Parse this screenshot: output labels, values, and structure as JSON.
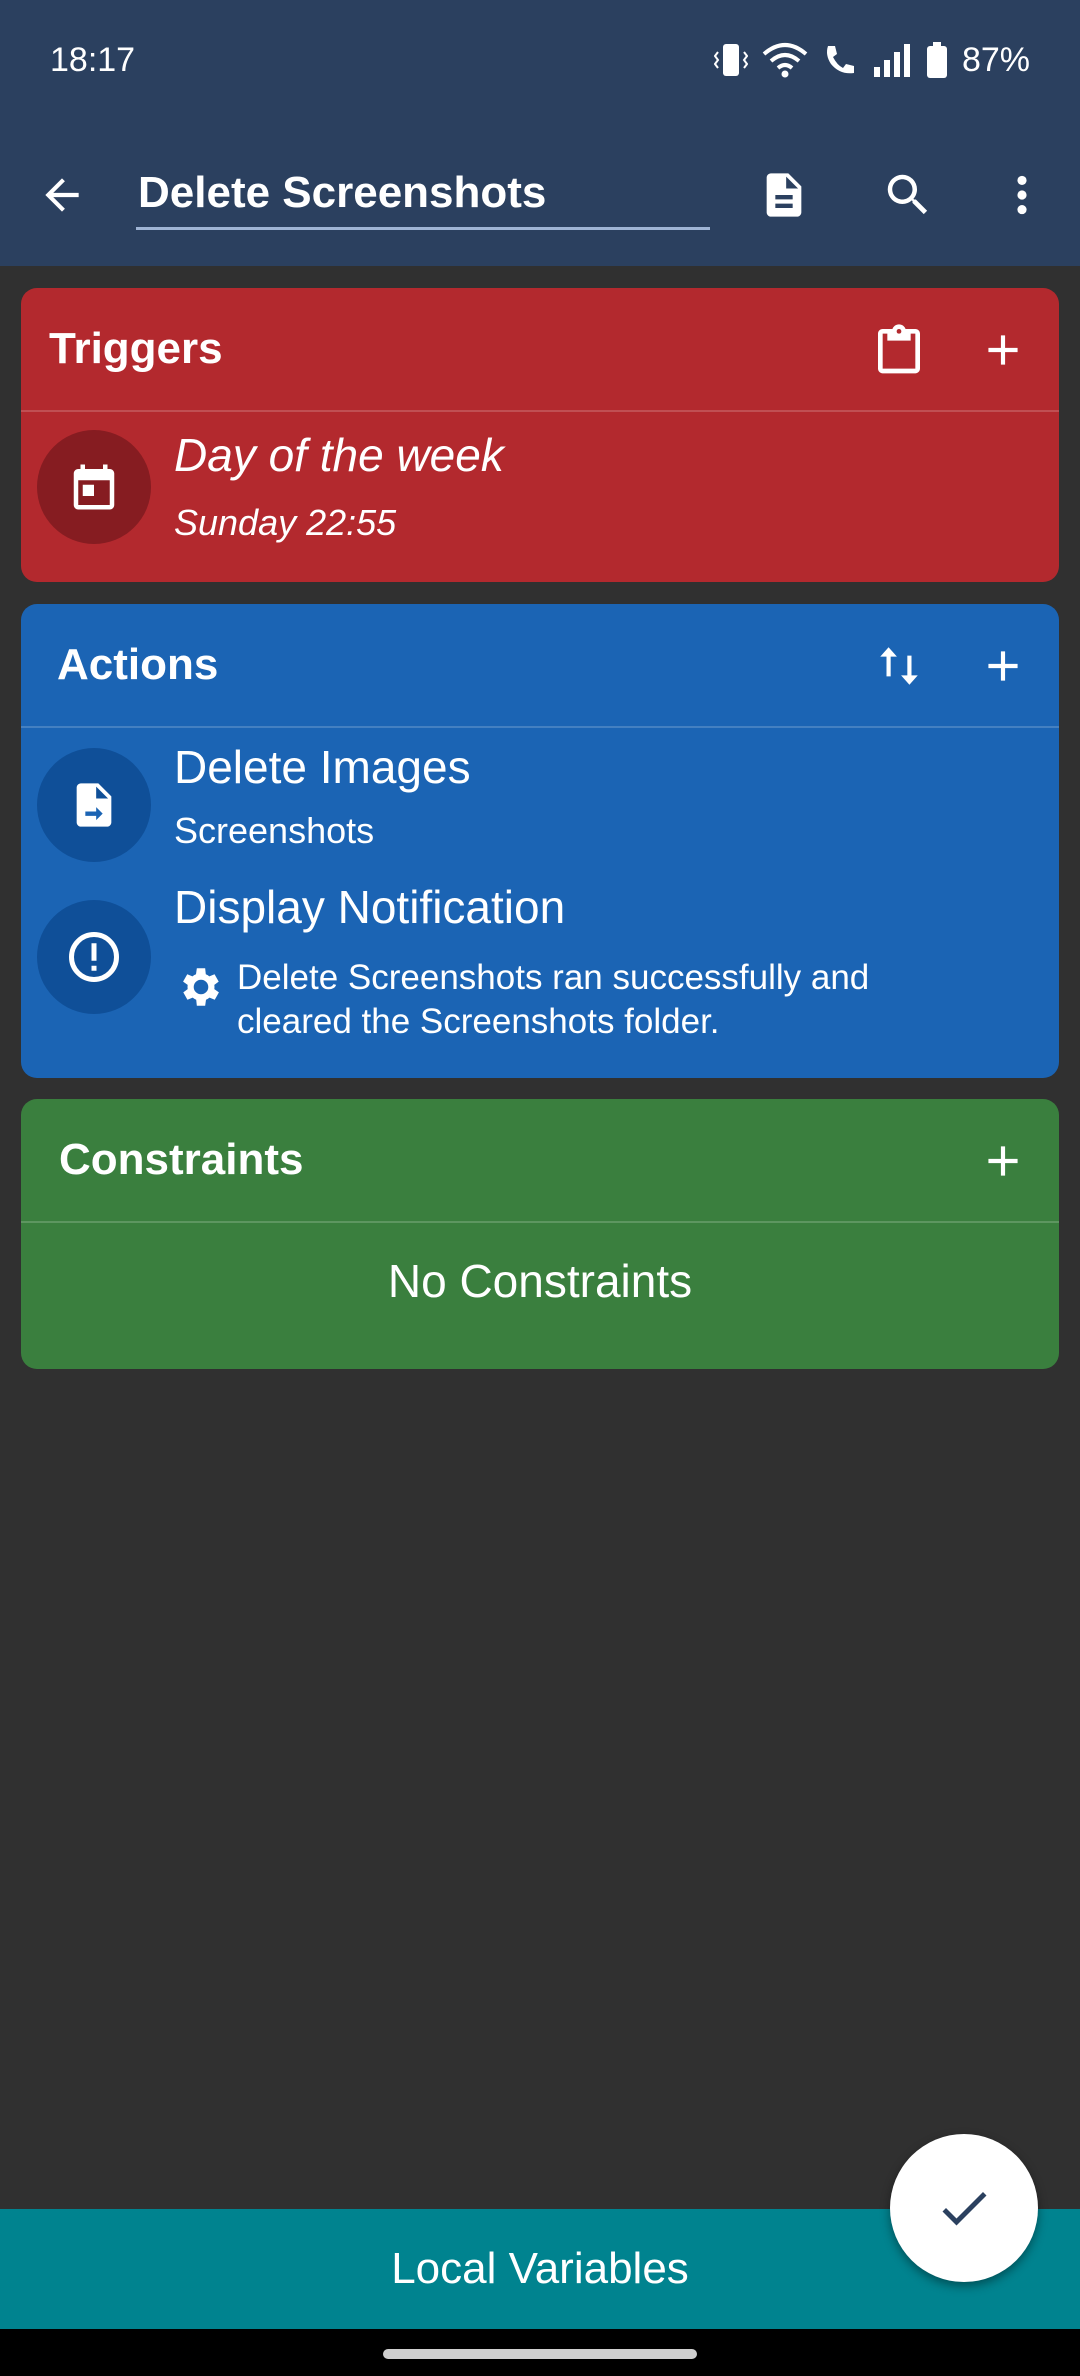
{
  "status_bar": {
    "time": "18:17",
    "battery": "87%"
  },
  "toolbar": {
    "title": "Delete Screenshots"
  },
  "triggers": {
    "title": "Triggers",
    "items": [
      {
        "title": "Day of the week",
        "subtitle": "Sunday 22:55"
      }
    ]
  },
  "actions": {
    "title": "Actions",
    "items": [
      {
        "title": "Delete Images",
        "subtitle": "Screenshots"
      },
      {
        "title": "Display Notification",
        "subtitle": "Delete Screenshots ran successfully and cleared the Screenshots folder."
      }
    ]
  },
  "constraints": {
    "title": "Constraints",
    "empty_text": "No Constraints"
  },
  "bottom": {
    "local_variables": "Local Variables"
  },
  "colors": {
    "appbar": "#2b405f",
    "triggers": "#b3292e",
    "actions": "#1b64b4",
    "constraints": "#3a7f3e",
    "bottom_bar": "#00838f"
  },
  "icons": {
    "back": "arrow-left-icon",
    "doc": "document-icon",
    "search": "search-icon",
    "more": "more-vert-icon",
    "clipboard": "clipboard-icon",
    "add": "plus-icon",
    "reorder": "swap-vertical-icon",
    "calendar": "calendar-icon",
    "file_move": "file-move-icon",
    "alert": "alert-circle-icon",
    "gear": "gear-icon",
    "check": "check-icon"
  }
}
